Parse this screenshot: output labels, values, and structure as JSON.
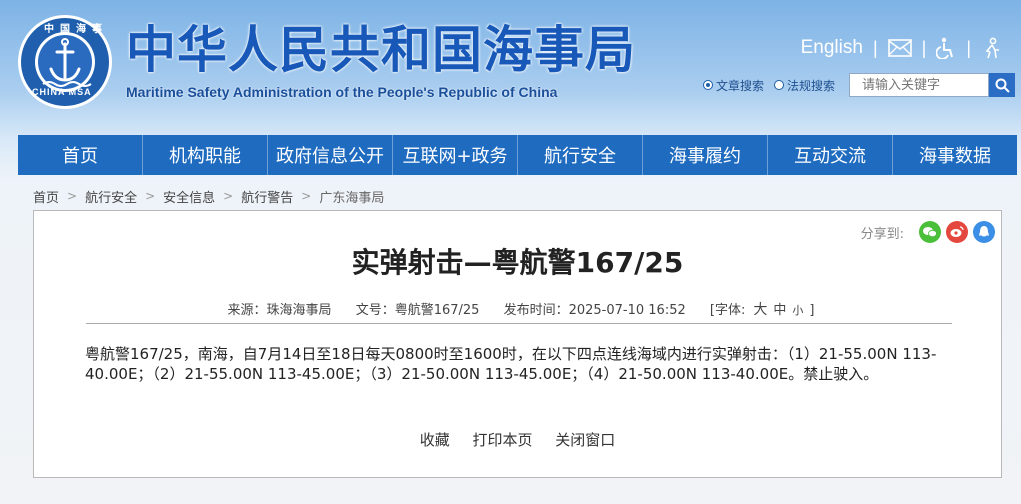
{
  "header": {
    "logo_text_top": "中国海事",
    "logo_text_bottom": "CHINA MSA",
    "title_cn": "中华人民共和国海事局",
    "title_en": "Maritime Safety Administration of the People's Republic of China",
    "english_link": "English",
    "sep": "|",
    "search": {
      "option1": "文章搜索",
      "option2": "法规搜索",
      "placeholder": "请输入关键字"
    }
  },
  "nav": [
    "首页",
    "机构职能",
    "政府信息公开",
    "互联网+政务",
    "航行安全",
    "海事履约",
    "互动交流",
    "海事数据"
  ],
  "breadcrumb": [
    "首页",
    "航行安全",
    "安全信息",
    "航行警告",
    "广东海事局"
  ],
  "breadcrumb_sep": ">",
  "share_label": "分享到:",
  "article": {
    "title": "实弹射击—粤航警167/25",
    "source": "来源：珠海海事局",
    "doc_no": "文号：粤航警167/25",
    "time": "发布时间：2025-07-10 16:52",
    "font_label": "[字体:",
    "size_large": "大",
    "size_mid": "中",
    "size_small": "小",
    "font_close": "]",
    "body": "粤航警167/25，南海，自7月14日至18日每天0800时至1600时，在以下四点连线海域内进行实弹射击：（1）21-55.00N 113-40.00E；（2）21-55.00N 113-45.00E；（3）21-50.00N 113-45.00E；（4）21-50.00N 113-40.00E。禁止驶入。"
  },
  "actions": {
    "favorite": "收藏",
    "print": "打印本页",
    "close": "关闭窗口"
  },
  "colors": {
    "nav_bg": "#1e6bbf",
    "title_blue": "#1858b8",
    "wechat": "#4cbf3a",
    "weibo": "#e4473d",
    "qq": "#3b8fe6"
  }
}
